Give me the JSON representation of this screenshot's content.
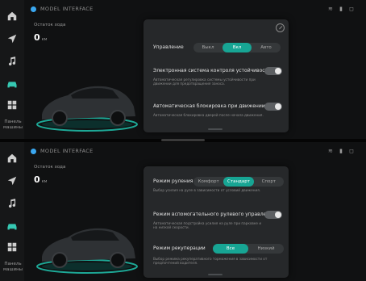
{
  "screens": [
    {
      "status_title": "MODEL INTERFACE",
      "status_icons": "≋ ▮ ◻",
      "range_label": "Остаток хода",
      "range_value": "0",
      "range_unit": "км",
      "sidebar_label": "Панель машины",
      "panel": {
        "row1_label": "Управление",
        "row1_options": [
          "Выкл",
          "Вкл",
          "Авто"
        ],
        "row1_active": 1,
        "row2_label": "Электронная система контроля устойчивости",
        "row2_desc": "Автоматическая регулировка системы устойчивости при движении для предотвращения заноса.",
        "row2_toggle": true,
        "row3_label": "Автоматическая блокировка при движении",
        "row3_desc": "Автоматическая блокировка дверей после начала движения.",
        "row3_toggle": true
      }
    },
    {
      "status_title": "MODEL INTERFACE",
      "status_icons": "≋ ▮ ◻",
      "range_label": "Остаток хода",
      "range_value": "0",
      "range_unit": "км",
      "sidebar_label": "Панель машины",
      "panel": {
        "row1_label": "Режим руления",
        "row1_options": [
          "Комфорт",
          "Стандарт",
          "Спорт"
        ],
        "row1_active": 1,
        "row1_desc": "Выбор усилия на руле в зависимости от условий движения.",
        "row2_label": "Режим вспомогательного рулевого управления",
        "row2_desc": "Автоматическая подстройка усилия на руле при парковке и на низкой скорости.",
        "row2_toggle": true,
        "row3_label": "Режим рекуперации",
        "row3_options": [
          "Все",
          "Низкий"
        ],
        "row3_active": 0,
        "row3_desc": "Выбор режима рекуперативного торможения в зависимости от предпочтений водителя."
      }
    }
  ],
  "colors": {
    "accent": "#17a594",
    "nav_active": "#36c9b3",
    "panel_bg": "#26282a"
  }
}
